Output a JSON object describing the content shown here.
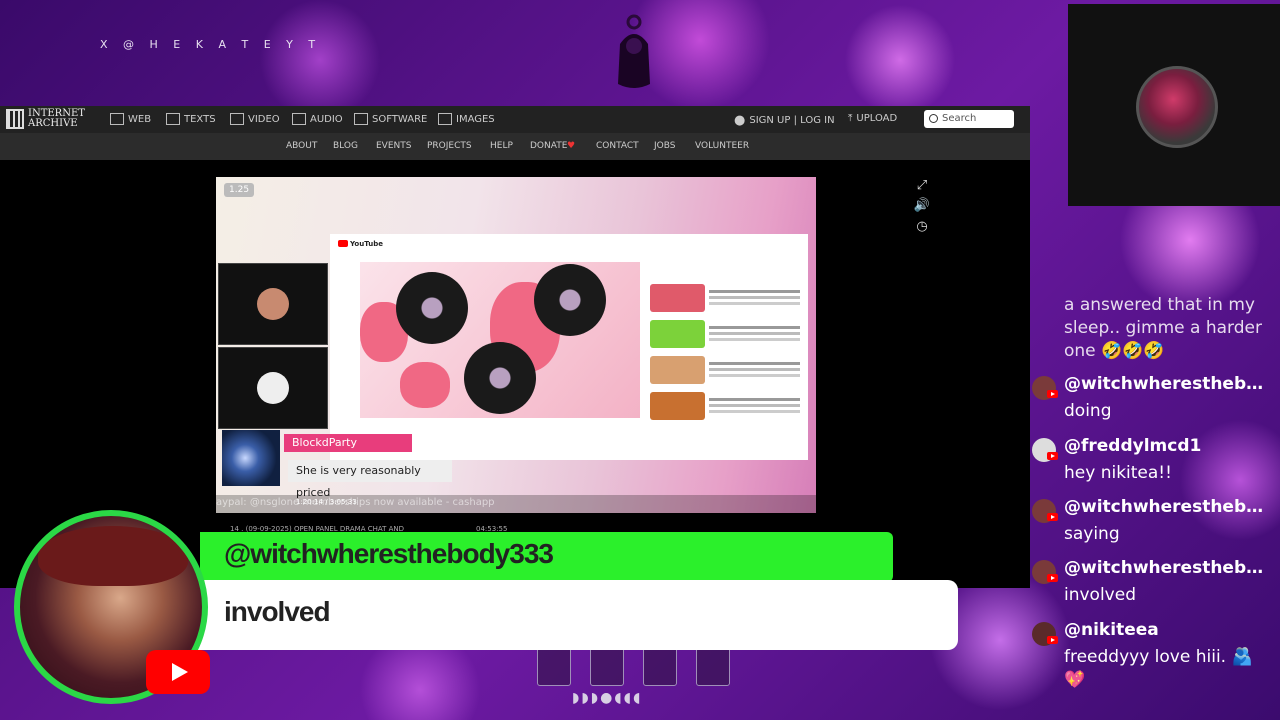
{
  "overlay": {
    "handle": "X @ H E K A T E Y T"
  },
  "archive": {
    "logo_line1": "INTERNET",
    "logo_line2": "ARCHIVE",
    "nav": [
      "WEB",
      "TEXTS",
      "VIDEO",
      "AUDIO",
      "SOFTWARE",
      "IMAGES"
    ],
    "account": "SIGN UP | LOG IN",
    "upload": "UPLOAD",
    "search_placeholder": "Search",
    "subnav": [
      "ABOUT",
      "BLOG",
      "EVENTS",
      "PROJECTS",
      "HELP",
      "DONATE",
      "CONTACT",
      "JOBS",
      "VOLUNTEER"
    ]
  },
  "video": {
    "speed": "1.25",
    "time": "1:20:14 / 3:05:33",
    "ticker": "aypal: @nsglone                    memberships now available - cashapp",
    "inner_chat": {
      "name": "BlockdParty",
      "message": "She is very reasonably priced"
    },
    "below_row": "14 . (09-09-2025) OPEN PANEL DRAMA CHAT AND",
    "below_duration": "04:53:55"
  },
  "chat": {
    "partial_message": "a answered that in my sleep.. gimme a harder one 🤣🤣🤣",
    "messages": [
      {
        "user": "@witchwheresthebody333",
        "text": "doing"
      },
      {
        "user": "@freddylmcd1",
        "text": "hey nikitea!!"
      },
      {
        "user": "@witchwheresthebody333",
        "text": "saying"
      },
      {
        "user": "@witchwheresthebody333",
        "text": "involved"
      },
      {
        "user": "@nikiteea",
        "text": "freeddyyy love hiii. 🫂💖"
      }
    ]
  },
  "alert": {
    "username": "@witchwheresthebody333",
    "message": "involved"
  },
  "colors": {
    "alert_green": "#2bf02b",
    "youtube_red": "#ff0000"
  }
}
